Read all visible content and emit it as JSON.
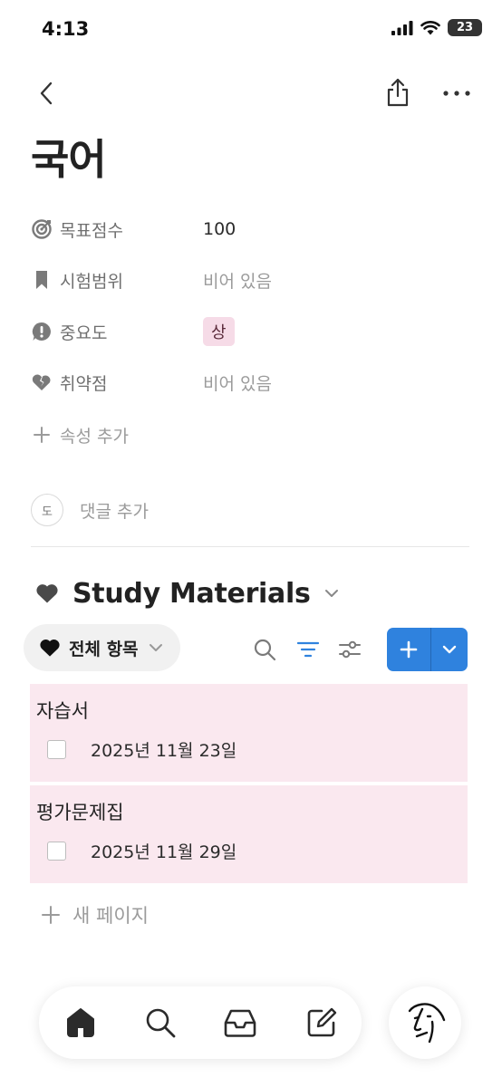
{
  "status_bar": {
    "time": "4:13",
    "battery": "23"
  },
  "page": {
    "title": "국어"
  },
  "properties": [
    {
      "label": "목표점수",
      "value": "100",
      "icon": "target-icon"
    },
    {
      "label": "시험범위",
      "value": "비어 있음",
      "icon": "bookmark-icon"
    },
    {
      "label": "중요도",
      "value": "상",
      "icon": "alert-bubble-icon"
    },
    {
      "label": "취약점",
      "value": "비어 있음",
      "icon": "broken-heart-icon"
    }
  ],
  "add_property_label": "속성 추가",
  "comment": {
    "avatar_initial": "도",
    "placeholder": "댓글 추가"
  },
  "database": {
    "title": "Study Materials",
    "view_label": "전체 항목",
    "items": [
      {
        "title": "자습서",
        "date": "2025년 11월 23일"
      },
      {
        "title": "평가문제집",
        "date": "2025년 11월 29일"
      }
    ],
    "new_page_label": "새 페이지"
  },
  "colors": {
    "accent": "#2f82de",
    "row_background": "#fae8ef",
    "tag_background": "#f6dbe7",
    "filter_active": "#2f82de"
  }
}
